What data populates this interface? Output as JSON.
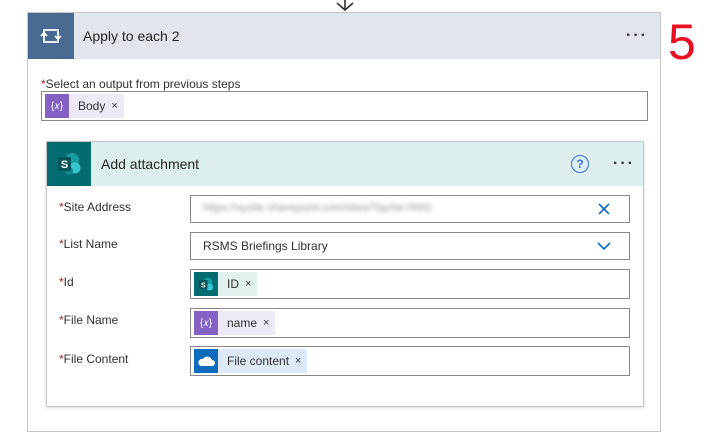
{
  "annotation": {
    "step_number": "5"
  },
  "loop": {
    "title": "Apply to each 2",
    "icon": "loop-icon",
    "more_label": "···",
    "select_output": {
      "required_mark": "*",
      "label": "Select an output from previous steps",
      "token": {
        "label": "Body",
        "icon": "expression-icon",
        "remove": "×"
      }
    }
  },
  "action": {
    "title": "Add attachment",
    "icon": "sharepoint-icon",
    "help_label": "?",
    "more_label": "···",
    "fields": {
      "site_address": {
        "required_mark": "*",
        "label": "Site Address",
        "value": "https://xyzite.sharepoint.com/sites/Tayrite-RMS"
      },
      "list_name": {
        "required_mark": "*",
        "label": "List Name",
        "value": "RSMS Briefings Library"
      },
      "id": {
        "required_mark": "*",
        "label": "Id",
        "token": {
          "label": "ID",
          "icon": "sharepoint-icon",
          "remove": "×"
        }
      },
      "file_name": {
        "required_mark": "*",
        "label": "File Name",
        "token": {
          "label": "name",
          "icon": "expression-icon",
          "remove": "×"
        }
      },
      "file_content": {
        "required_mark": "*",
        "label": "File Content",
        "token": {
          "label": "File content",
          "icon": "onedrive-icon",
          "remove": "×"
        }
      }
    }
  },
  "colors": {
    "loop_header": "#e1e6ec",
    "loop_icon_bg": "#486991",
    "action_header": "#dcefee",
    "sharepoint_bg": "#036c70",
    "expression_bg": "#8661c5",
    "onedrive_bg": "#0f6cbd",
    "annotation": "#e81123"
  }
}
